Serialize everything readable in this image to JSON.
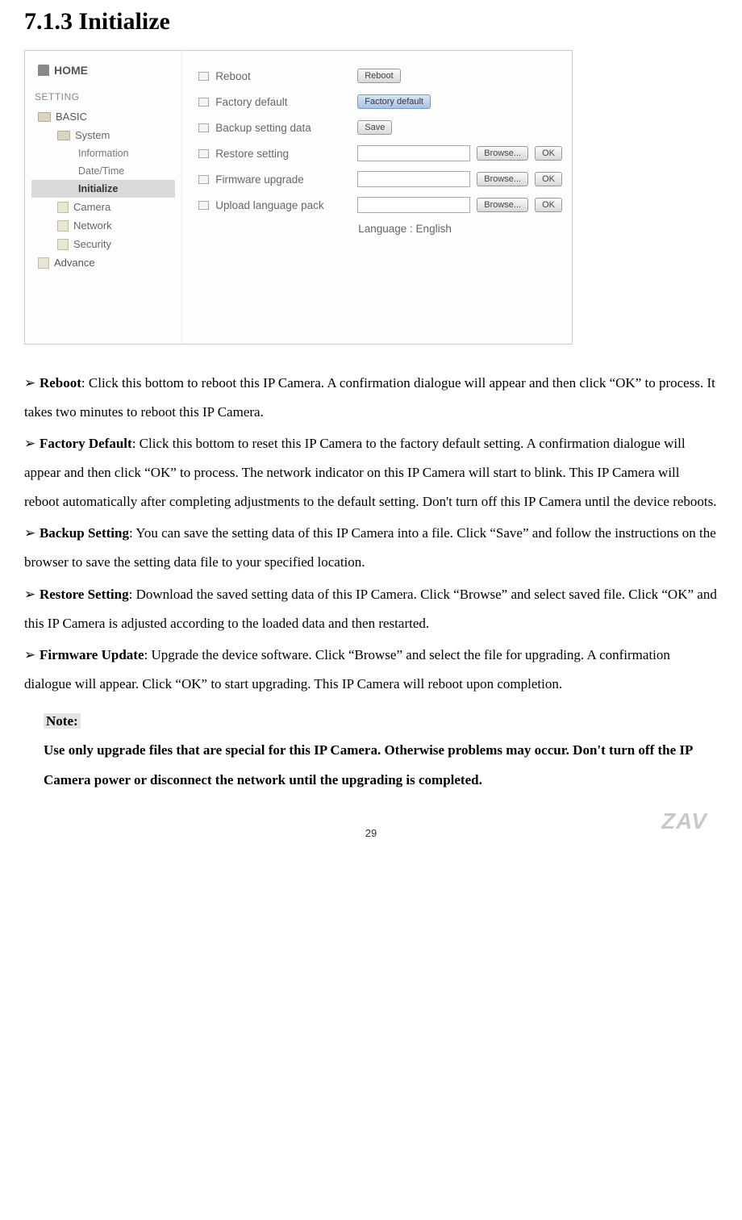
{
  "heading": "7.1.3 Initialize",
  "screenshot": {
    "nav": {
      "home": "HOME",
      "setting": "SETTING",
      "basic": "BASIC",
      "system": "System",
      "subitems": {
        "information": "Information",
        "datetime": "Date/Time",
        "initialize": "Initialize"
      },
      "camera": "Camera",
      "network": "Network",
      "security": "Security",
      "advance": "Advance"
    },
    "rows": {
      "reboot": {
        "label": "Reboot",
        "button": "Reboot"
      },
      "factory": {
        "label": "Factory default",
        "button": "Factory default"
      },
      "backup": {
        "label": "Backup setting data",
        "button": "Save"
      },
      "restore": {
        "label": "Restore setting",
        "browse": "Browse...",
        "ok": "OK"
      },
      "firmware": {
        "label": "Firmware upgrade",
        "browse": "Browse...",
        "ok": "OK"
      },
      "language": {
        "label": "Upload language pack",
        "browse": "Browse...",
        "ok": "OK"
      },
      "langline": "Language : English"
    }
  },
  "paragraphs": {
    "p1_title": "Reboot",
    "p1_body": ": Click this bottom to reboot this IP Camera. A confirmation dialogue will appear and then click “OK” to process. It takes two minutes to reboot this IP Camera.",
    "p2_title": "Factory Default",
    "p2_body": ": Click this bottom to reset this IP Camera to the factory default setting. A confirmation dialogue will appear and then click “OK” to process. The network indicator on this IP Camera will start to blink. This IP Camera will reboot automatically after completing adjustments to the default setting. Don't turn off this IP Camera until the device reboots.",
    "p3_title": "Backup Setting",
    "p3_body": ": You can save the setting data of this IP Camera into a file. Click “Save” and follow the instructions on the browser to save the setting data file to your specified location.",
    "p4_title": "Restore Setting",
    "p4_body": ": Download the saved setting data of this IP Camera. Click “Browse” and select saved file. Click “OK” and this IP Camera is adjusted according to the loaded data and then restarted.",
    "p5_title": "Firmware Update",
    "p5_body": ": Upgrade the device software. Click “Browse” and select the file for upgrading. A confirmation dialogue will appear. Click “OK” to start upgrading. This IP Camera will reboot upon completion."
  },
  "note": {
    "label": "Note:",
    "body": "Use only upgrade files that are special for this IP Camera. Otherwise problems may occur. Don't turn off the IP Camera power or disconnect the network until the upgrading is completed."
  },
  "page_number": "29",
  "footer_logo": "ZAV"
}
